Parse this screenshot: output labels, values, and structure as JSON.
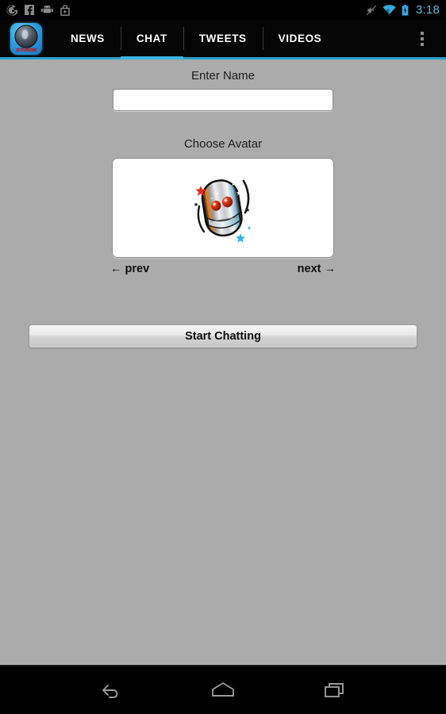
{
  "status_bar": {
    "notification_icons": [
      "google-icon",
      "facebook-icon",
      "android-icon",
      "play-store-icon"
    ],
    "system_icons": [
      "mute-icon",
      "wifi-icon",
      "battery-charging-icon"
    ],
    "time": "3:18",
    "time_color": "#5BB8E8"
  },
  "action_bar": {
    "app_icon_name": "app-logo-icon",
    "app_icon_text": "GTHROM",
    "tabs": [
      {
        "label": "NEWS",
        "active": false
      },
      {
        "label": "CHAT",
        "active": true
      },
      {
        "label": "TWEETS",
        "active": false
      },
      {
        "label": "VIDEOS",
        "active": false
      }
    ],
    "active_tab_color": "#3ab3e2",
    "overflow_label": "More options"
  },
  "main": {
    "name_section": {
      "label": "Enter Name",
      "value": "",
      "placeholder": ""
    },
    "avatar_section": {
      "label": "Choose Avatar",
      "avatar_name": "robot-avatar",
      "prev_label": "← prev",
      "next_label": "next →"
    },
    "start_button_label": "Start Chatting",
    "background_color": "#ababab"
  },
  "nav_bar": {
    "buttons": [
      "back-icon",
      "home-icon",
      "recents-icon"
    ]
  }
}
